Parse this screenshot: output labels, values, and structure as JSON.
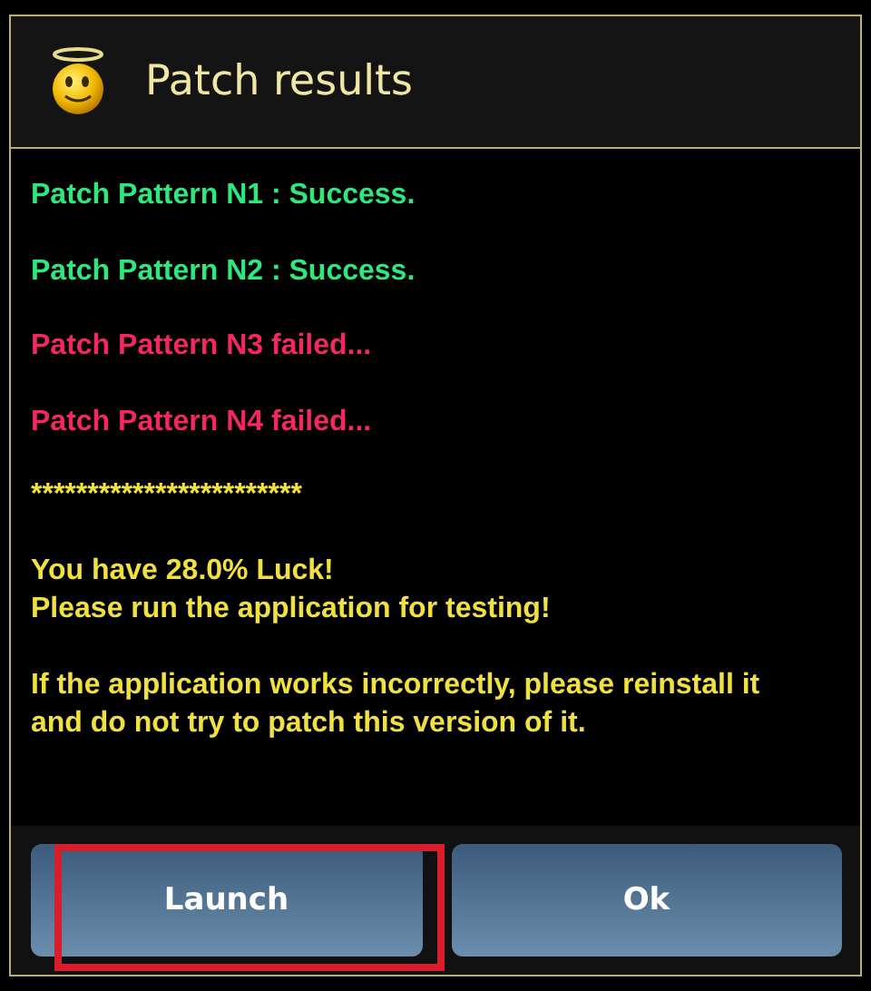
{
  "dialog": {
    "title": "Patch results"
  },
  "results": [
    {
      "text": "Patch Pattern N1 : Success.",
      "color": "#2ee87e"
    },
    {
      "text": "Patch Pattern N2 : Success.",
      "color": "#2ee87e"
    },
    {
      "text": "Patch Pattern N3 failed...",
      "color": "#f2285e"
    },
    {
      "text": "Patch Pattern N4 failed...",
      "color": "#f2285e"
    }
  ],
  "separator": "************************",
  "message": [
    [
      "You have 28.0% Luck!",
      "Please run the application for testing!"
    ],
    [
      "If the application works incorrectly, please reinstall it",
      "and do not try to patch this version of it."
    ]
  ],
  "buttons": [
    {
      "label": "Launch",
      "highlighted": true
    },
    {
      "label": "Ok",
      "highlighted": false
    }
  ]
}
